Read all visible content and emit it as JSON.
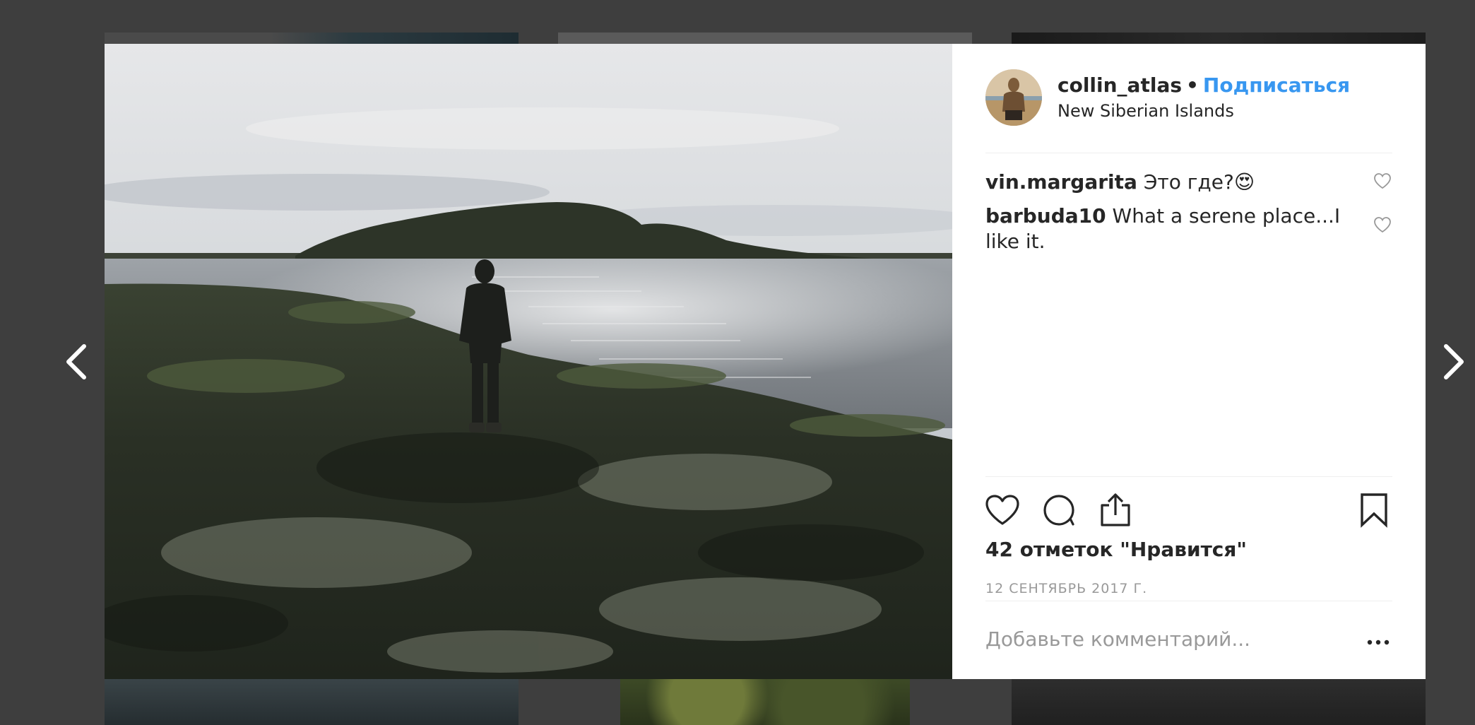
{
  "post": {
    "author": {
      "username": "collin_atlas",
      "separator": "•",
      "follow_label": "Подписаться",
      "location": "New Siberian Islands"
    },
    "comments": [
      {
        "username": "vin.margarita",
        "text": "Это где?😍"
      },
      {
        "username": "barbuda10",
        "text": "What a serene place...I like it."
      }
    ],
    "likes_label": "42 отметок \"Нравится\"",
    "date_label": "12 СЕНТЯБРЬ 2017 Г.",
    "comment_placeholder": "Добавьте комментарий..."
  },
  "icons": {
    "prev": "chevron-left-icon",
    "next": "chevron-right-icon",
    "like": "heart-icon",
    "comment": "comment-bubble-icon",
    "share": "share-icon",
    "save": "bookmark-icon",
    "more": "ellipsis-icon"
  },
  "colors": {
    "accent": "#3897f0",
    "text": "#262626",
    "muted": "#999999",
    "overlay": "#3e3e3e"
  }
}
